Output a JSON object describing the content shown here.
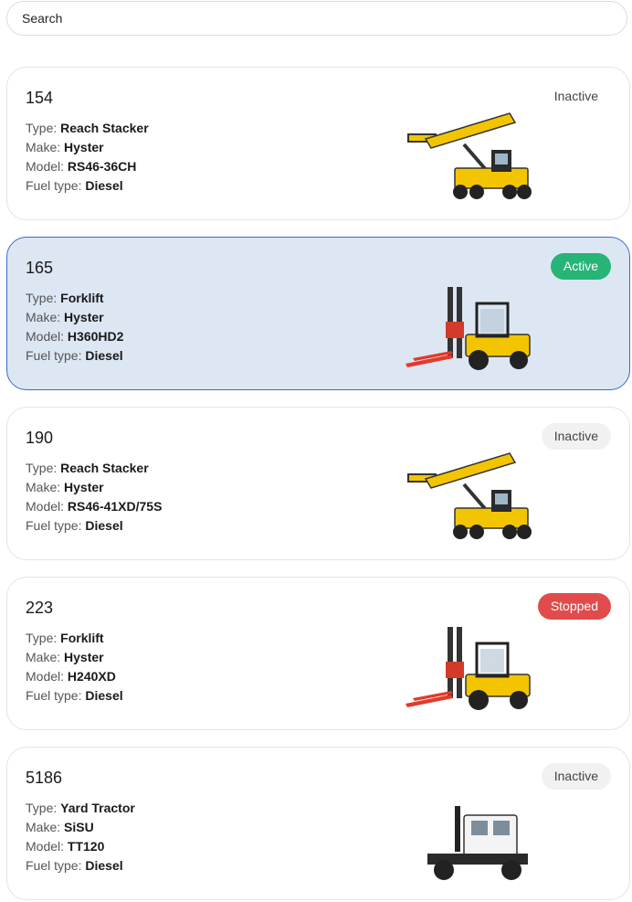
{
  "search": {
    "placeholder": "Search"
  },
  "labels": {
    "type": "Type: ",
    "make": "Make: ",
    "model": "Model: ",
    "fuel": "Fuel type: "
  },
  "colors": {
    "selected_border": "#2f6fd0",
    "selected_bg": "#dde6f3",
    "active": "#26b477",
    "stopped": "#e24b4b",
    "machine_yellow": "#f2c500"
  },
  "vehicles": [
    {
      "id": "154",
      "status": "Inactive",
      "type": "Reach Stacker",
      "make": "Hyster",
      "model": "RS46-36CH",
      "fuel": "Diesel",
      "icon": "reach-stacker-icon"
    },
    {
      "id": "165",
      "status": "Active",
      "type": "Forklift",
      "make": "Hyster",
      "model": "H360HD2",
      "fuel": "Diesel",
      "icon": "forklift-icon",
      "selected": true
    },
    {
      "id": "190",
      "status": "Inactive",
      "type": "Reach Stacker",
      "make": "Hyster",
      "model": "RS46-41XD/75S",
      "fuel": "Diesel",
      "icon": "reach-stacker-icon"
    },
    {
      "id": "223",
      "status": "Stopped",
      "type": "Forklift",
      "make": "Hyster",
      "model": "H240XD",
      "fuel": "Diesel",
      "icon": "forklift-icon"
    },
    {
      "id": "5186",
      "status": "Inactive",
      "type": "Yard Tractor",
      "make": "SiSU",
      "model": "TT120",
      "fuel": "Diesel",
      "icon": "yard-tractor-icon"
    }
  ]
}
